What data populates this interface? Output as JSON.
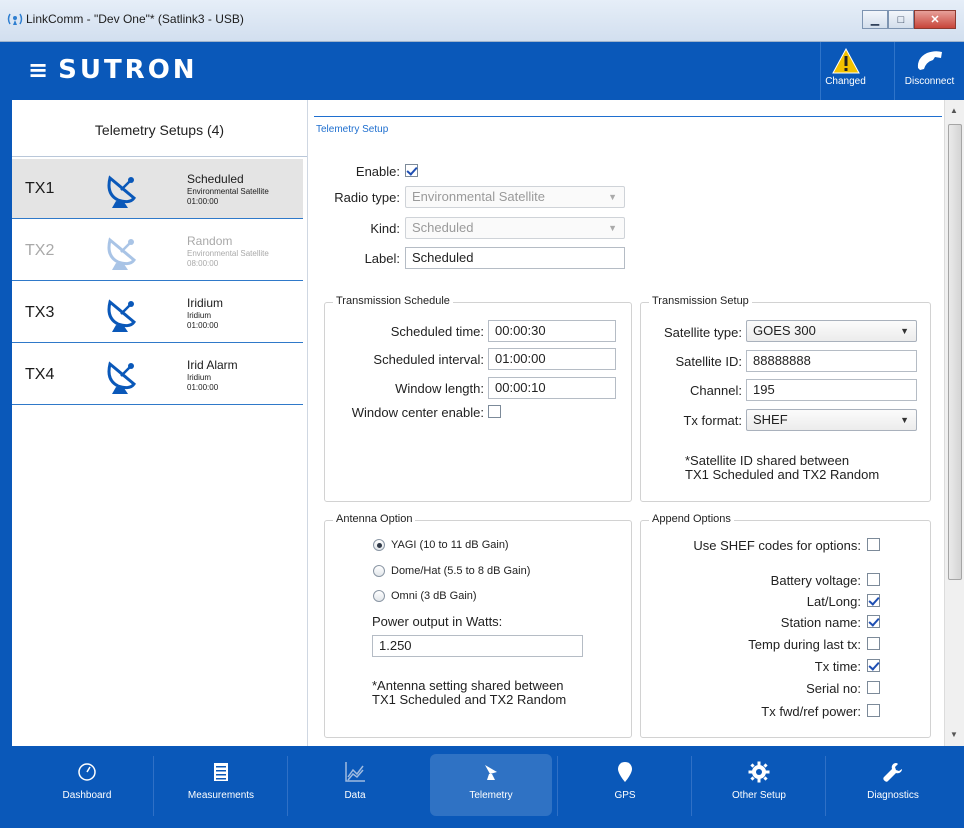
{
  "window": {
    "title": "LinkComm - \"Dev One\"* (Satlink3 - USB)",
    "minimize": "▭",
    "maximize": "▭",
    "close": "✕"
  },
  "header": {
    "logo": "SUTRON",
    "changed_label": "Changed",
    "disconnect_label": "Disconnect"
  },
  "left": {
    "title": "Telemetry Setups (4)",
    "items": [
      {
        "name": "TX1",
        "kind": "Scheduled",
        "sub": "Environmental Satellite",
        "time": "01:00:00"
      },
      {
        "name": "TX2",
        "kind": "Random",
        "sub": "Environmental Satellite",
        "time": "08:00:00"
      },
      {
        "name": "TX3",
        "kind": "Iridium",
        "sub": "Iridium",
        "time": "01:00:00"
      },
      {
        "name": "TX4",
        "kind": "Irid Alarm",
        "sub": "Iridium",
        "time": "01:00:00"
      }
    ]
  },
  "main": {
    "section_title": "Telemetry Setup",
    "enable_label": "Enable:",
    "radio_type_label": "Radio type:",
    "radio_type_value": "Environmental Satellite",
    "kind_label": "Kind:",
    "kind_value": "Scheduled",
    "label_label": "Label:",
    "label_value": "Scheduled",
    "schedule": {
      "title": "Transmission Schedule",
      "sched_time_label": "Scheduled time:",
      "sched_time": "00:00:30",
      "interval_label": "Scheduled interval:",
      "interval": "01:00:00",
      "window_label": "Window length:",
      "window": "00:00:10",
      "center_label": "Window center enable:"
    },
    "setup": {
      "title": "Transmission Setup",
      "sat_type_label": "Satellite type:",
      "sat_type": "GOES 300",
      "sat_id_label": "Satellite ID:",
      "sat_id": "88888888",
      "channel_label": "Channel:",
      "channel": "195",
      "tx_format_label": "Tx format:",
      "tx_format": "SHEF",
      "note1": "*Satellite ID shared between",
      "note2": "TX1 Scheduled and TX2 Random"
    },
    "antenna": {
      "title": "Antenna Option",
      "opt1": "YAGI (10 to 11 dB Gain)",
      "opt2": "Dome/Hat (5.5 to 8 dB Gain)",
      "opt3": "Omni (3 dB Gain)",
      "power_label": "Power output in Watts:",
      "power": "1.250",
      "note1": "*Antenna setting shared between",
      "note2": "TX1 Scheduled and TX2 Random"
    },
    "append": {
      "title": "Append Options",
      "shef_label": "Use SHEF codes for options:",
      "battery": "Battery voltage:",
      "latlong": "Lat/Long:",
      "station": "Station name:",
      "temp": "Temp during last tx:",
      "txtime": "Tx time:",
      "serial": "Serial no:",
      "fwdref": "Tx fwd/ref power:"
    }
  },
  "nav": {
    "dashboard": "Dashboard",
    "measurements": "Measurements",
    "data": "Data",
    "telemetry": "Telemetry",
    "gps": "GPS",
    "other": "Other Setup",
    "diagnostics": "Diagnostics"
  },
  "colors": {
    "brand_blue": "#0a58b9",
    "accent": "#1f6fcf",
    "warning": "#f2c200"
  }
}
